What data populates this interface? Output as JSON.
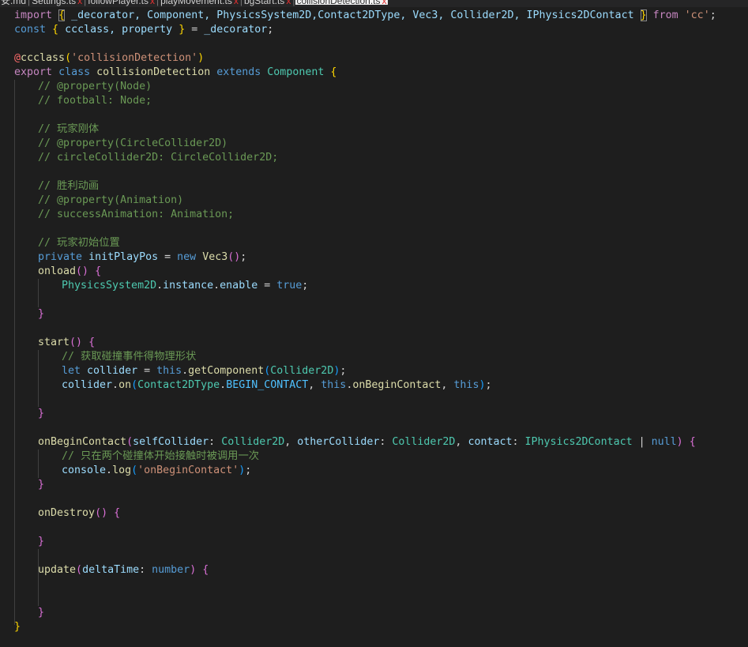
{
  "tabs": [
    {
      "label": "安.md",
      "closable": false
    },
    {
      "label": "Settings.ts",
      "closable": true
    },
    {
      "label": "followPlayer.ts",
      "closable": true
    },
    {
      "label": "playMovement.ts",
      "closable": true
    },
    {
      "label": "bgStart.ts",
      "closable": true
    },
    {
      "label": "collisionDetection.ts",
      "closable": true,
      "active": true
    }
  ],
  "close_glyph": "x",
  "code": {
    "l1": {
      "import": "import",
      "names": "_decorator, Component, PhysicsSystem2D,Contact2DType, Vec3, Collider2D, IPhysics2DContact",
      "from": "from",
      "module": "'cc'"
    },
    "l2": {
      "const": "const",
      "names": "ccclass, property",
      "decorator": "_decorator"
    },
    "l4": {
      "at": "@",
      "fn": "ccclass",
      "arg": "'collisionDetection'"
    },
    "l5": {
      "export": "export",
      "class": "class",
      "name": "collisionDetection",
      "extends": "extends",
      "base": "Component"
    },
    "l6": "// @property(Node)",
    "l7": "// football: Node;",
    "l9": "// 玩家刚体",
    "l10": "// @property(CircleCollider2D)",
    "l11": "// circleCollider2D: CircleCollider2D;",
    "l13": "// 胜利动画",
    "l14": "// @property(Animation)",
    "l15": "// successAnimation: Animation;",
    "l17": "// 玩家初始位置",
    "l18": {
      "private": "private",
      "name": "initPlayPos",
      "new": "new",
      "type": "Vec3"
    },
    "l19": {
      "name": "onload"
    },
    "l20": {
      "obj": "PhysicsSystem2D",
      "p1": "instance",
      "p2": "enable",
      "val": "true"
    },
    "l24": {
      "name": "start"
    },
    "l25": "// 获取碰撞事件得物理形状",
    "l26": {
      "let": "let",
      "name": "collider",
      "this": "this",
      "method": "getComponent",
      "arg": "Collider2D"
    },
    "l27": {
      "obj": "collider",
      "method": "on",
      "enum": "Contact2DType",
      "member": "BEGIN_CONTACT",
      "this": "this",
      "cb": "onBeginContact",
      "this2": "this"
    },
    "l30": {
      "name": "onBeginContact",
      "p1": "selfCollider",
      "t1": "Collider2D",
      "p2": "otherCollider",
      "t2": "Collider2D",
      "p3": "contact",
      "t3": "IPhysics2DContact",
      "null": "null"
    },
    "l31": "// 只在两个碰撞体开始接触时被调用一次",
    "l32": {
      "obj": "console",
      "method": "log",
      "arg": "'onBeginContact'"
    },
    "l35": {
      "name": "onDestroy"
    },
    "l38": {
      "name": "update",
      "param": "deltaTime",
      "type": "number"
    }
  }
}
